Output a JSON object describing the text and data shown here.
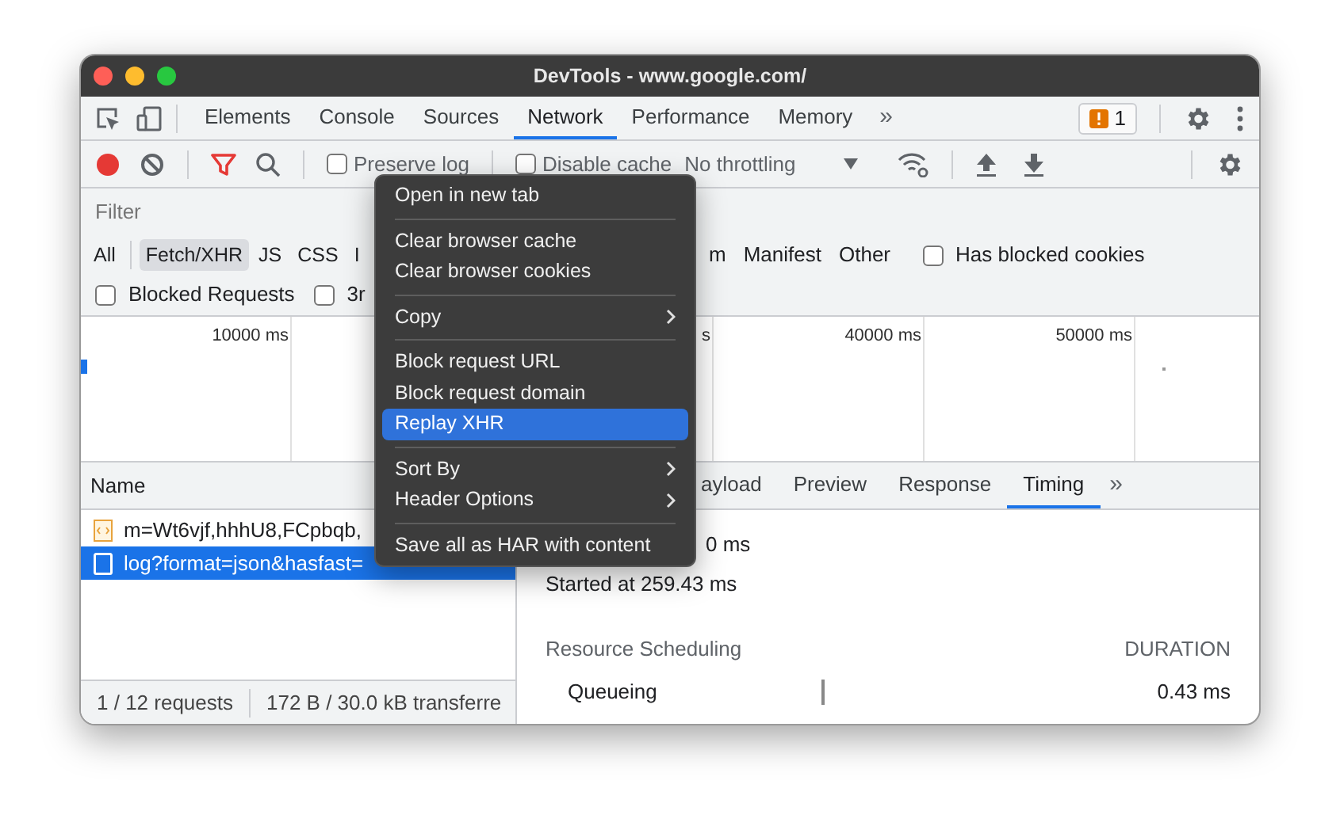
{
  "window": {
    "title": "DevTools - www.google.com/"
  },
  "panel_tabs": [
    {
      "label": "Elements",
      "selected": false
    },
    {
      "label": "Console",
      "selected": false
    },
    {
      "label": "Sources",
      "selected": false
    },
    {
      "label": "Network",
      "selected": true
    },
    {
      "label": "Performance",
      "selected": false
    },
    {
      "label": "Memory",
      "selected": false
    }
  ],
  "more_tabs": "»",
  "issues_badge": {
    "count": "1"
  },
  "toolbar": {
    "recording": true,
    "filter_active": true,
    "preserve_log": {
      "label": "Preserve log",
      "checked": false
    },
    "disable_cache": {
      "label": "Disable cache",
      "checked": false
    },
    "throttling": "No throttling"
  },
  "filter": {
    "placeholder": "Filter"
  },
  "type_filters_left": [
    {
      "label": "All",
      "selected": false
    },
    {
      "label": "Fetch/XHR",
      "selected": true
    },
    {
      "label": "JS",
      "selected": false
    },
    {
      "label": "CSS",
      "selected": false
    },
    {
      "label": "I",
      "selected": false
    }
  ],
  "type_filters_right": [
    {
      "label": "m",
      "selected": false
    },
    {
      "label": "Manifest",
      "selected": false
    },
    {
      "label": "Other",
      "selected": false
    }
  ],
  "has_blocked_cookies": {
    "label": "Has blocked cookies",
    "checked": false
  },
  "blocked_requests": {
    "label": "Blocked Requests",
    "checked": false
  },
  "third_party": {
    "label": "3r",
    "checked": false
  },
  "timeline": {
    "ticks": [
      "10000 ms",
      "s",
      "40000 ms",
      "50000 ms"
    ]
  },
  "requests": {
    "column": "Name",
    "rows": [
      {
        "name": "m=Wt6vjf,hhhU8,FCpbqb,",
        "kind": "script",
        "selected": false
      },
      {
        "name": "log?format=json&hasfast=",
        "kind": "document",
        "selected": true
      }
    ]
  },
  "detail_tabs": [
    {
      "label": "ayload",
      "selected": false
    },
    {
      "label": "Preview",
      "selected": false
    },
    {
      "label": "Response",
      "selected": false
    },
    {
      "label": "Timing",
      "selected": true
    }
  ],
  "detail_more": "»",
  "timing": {
    "lines": [
      "0 ms",
      "Started at 259.43 ms"
    ],
    "section": "Resource Scheduling",
    "duration_header": "DURATION",
    "rows": [
      {
        "label": "Queueing",
        "value": "0.43 ms"
      }
    ]
  },
  "status_bar": [
    "1 / 12 requests",
    "172 B / 30.0 kB transferre"
  ],
  "context_menu": {
    "groups": [
      [
        {
          "label": "Open in new tab",
          "submenu": false,
          "selected": false
        }
      ],
      [
        {
          "label": "Clear browser cache",
          "submenu": false,
          "selected": false
        },
        {
          "label": "Clear browser cookies",
          "submenu": false,
          "selected": false
        }
      ],
      [
        {
          "label": "Copy",
          "submenu": true,
          "selected": false
        }
      ],
      [
        {
          "label": "Block request URL",
          "submenu": false,
          "selected": false
        },
        {
          "label": "Block request domain",
          "submenu": false,
          "selected": false
        },
        {
          "label": "Replay XHR",
          "submenu": false,
          "selected": true
        }
      ],
      [
        {
          "label": "Sort By",
          "submenu": true,
          "selected": false
        },
        {
          "label": "Header Options",
          "submenu": true,
          "selected": false
        }
      ],
      [
        {
          "label": "Save all as HAR with content",
          "submenu": false,
          "selected": false
        }
      ]
    ]
  }
}
